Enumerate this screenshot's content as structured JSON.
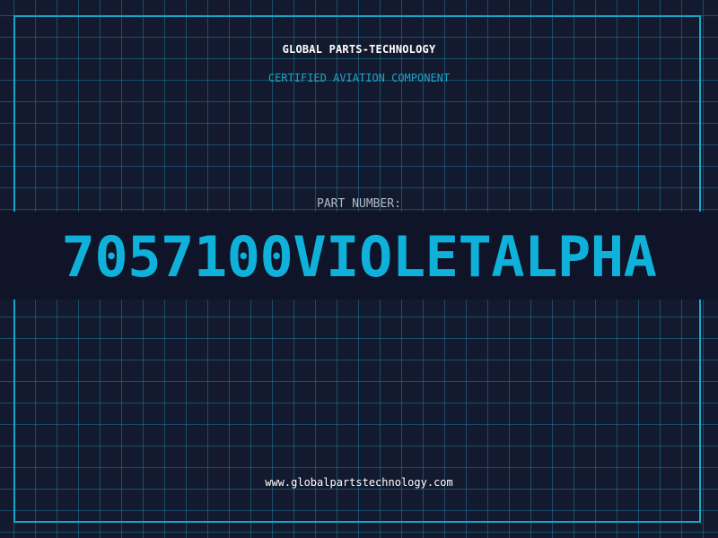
{
  "header": {
    "brand": "GLOBAL PARTS-TECHNOLOGY",
    "subtitle": "CERTIFIED AVIATION COMPONENT"
  },
  "part": {
    "label": "PART NUMBER:",
    "number": "7057100VIOLETALPHA"
  },
  "footer": {
    "url": "www.globalpartstechnology.com"
  },
  "colors": {
    "background": "#131a2f",
    "grid": "#1e6f86",
    "accent": "#1aa6c7",
    "part_number": "#0fb0d9",
    "text": "#ffffff",
    "label": "#b3b9c6"
  }
}
